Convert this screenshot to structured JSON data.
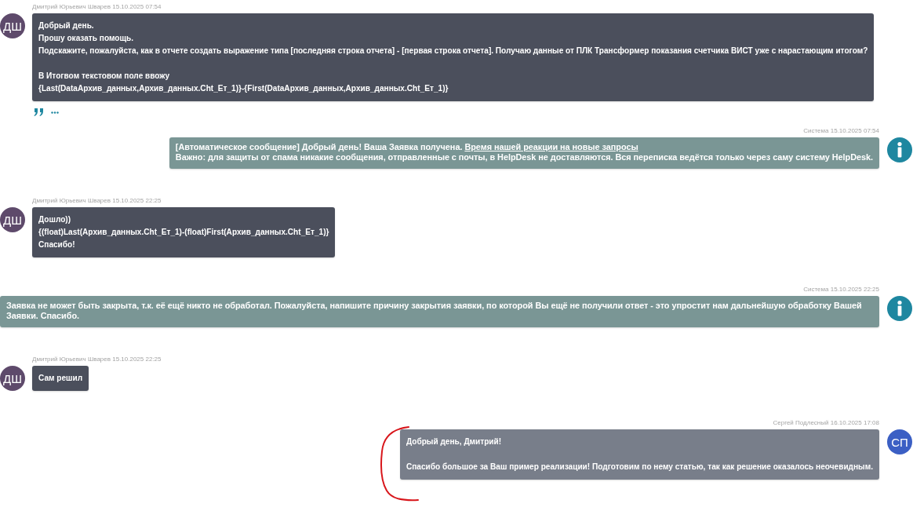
{
  "messages": [
    {
      "kind": "incoming",
      "meta": "Дмитрий Юрьевич Шварев 15.10.2025 07:54",
      "initials": "ДШ",
      "paragraphs": [
        [
          "Добрый день.",
          "Прошу оказать помощь.",
          "Подскажите, пожалуйста, как в отчете создать выражение типа [последняя строка отчета] - [первая строка отчета]. Получаю данные от ПЛК Трансформер показания счетчика ВИСТ уже с нарастающим итогом?"
        ],
        [
          "В Итогвом текстовом поле ввожу",
          "{Last(DataАрхив_данных,Архив_данных.Cht_Ет_1)}-{First(DataАрхив_данных,Архив_данных.Cht_Ет_1)}"
        ]
      ],
      "actions": true
    },
    {
      "kind": "system",
      "meta": "Система 15.10.2025 07:54",
      "lines": [
        {
          "text": "[Автоматическое сообщение] Добрый день! Ваша Заявка получена. ",
          "link": "Время нашей реакции на новые запросы"
        },
        {
          "text": "Важно: для защиты от спама никакие сообщения, отправленные с почты, в HelpDesk не доставляются. Вся переписка ведётся только через саму систему HelpDesk."
        }
      ]
    },
    {
      "kind": "incoming",
      "meta": "Дмитрий Юрьевич Шварев 15.10.2025 22:25",
      "initials": "ДШ",
      "paragraphs": [
        [
          "Дошло))",
          "{(float)Last(Архив_данных.Cht_Ет_1)-(float)First(Архив_данных.Cht_Ет_1)}",
          "Спасибо!"
        ]
      ]
    },
    {
      "kind": "system",
      "meta": "Система 15.10.2025 22:25",
      "lines": [
        {
          "text": "Заявка не может быть закрыта, т.к. её ещё никто не обработал. Пожалуйста, напишите причину закрытия заявки, по которой Вы ещё не получили ответ - это упростит нам дальнейшую обработку Вашей Заявки. Спасибо."
        }
      ]
    },
    {
      "kind": "incoming",
      "meta": "Дмитрий Юрьевич Шварев 15.10.2025 22:25",
      "initials": "ДШ",
      "paragraphs": [
        [
          "Сам решил"
        ]
      ]
    },
    {
      "kind": "outgoing",
      "meta": "Сергей Подлесный 16.10.2025 17:08",
      "initials": "СП",
      "paragraphs": [
        [
          "Добрый день, Дмитрий!"
        ],
        [
          "Спасибо большое за Ваш пример реализации! Подготовим по нему статью, так как решение оказалось неочевидным."
        ]
      ]
    }
  ]
}
